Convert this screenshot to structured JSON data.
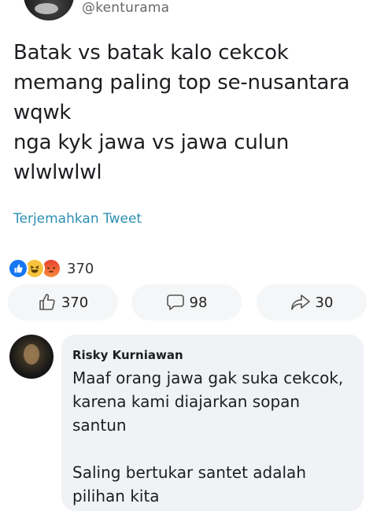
{
  "post": {
    "handle": "@kenturama",
    "text": "Batak vs batak kalo cekcok\nmemang paling top se-nusantara\nwqwk\nnga kyk jawa vs jawa culun\nwlwlwlwl",
    "translate_label": "Terjemahkan Tweet"
  },
  "reactions": {
    "icons": [
      "like-icon",
      "haha-icon",
      "angry-icon"
    ],
    "count": "370"
  },
  "actions": {
    "like_count": "370",
    "comment_count": "98",
    "share_count": "30"
  },
  "comment": {
    "author": "Risky Kurniawan",
    "text": "Maaf orang jawa gak suka cekcok,\nkarena kami diajarkan sopan\nsantun\n\nSaling bertukar santet adalah\npilihan kita"
  },
  "colors": {
    "link": "#2e8fb3",
    "like_blue": "#1877f2",
    "bubble": "#f0f2f5",
    "button_bg": "#f5f6f7"
  }
}
